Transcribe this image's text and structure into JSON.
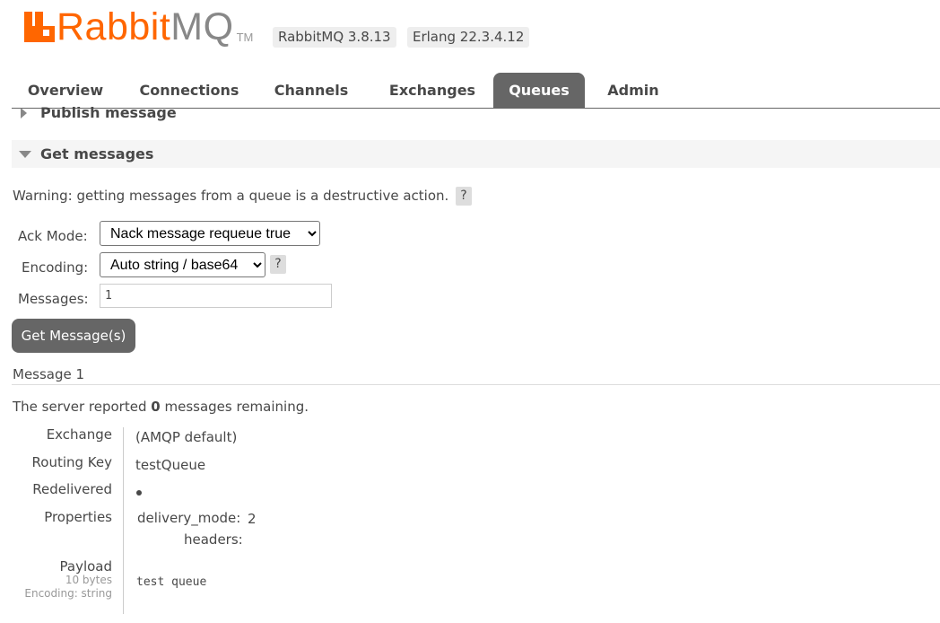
{
  "header": {
    "logo": {
      "brand": "Rabbit",
      "brand_suffix": "MQ",
      "trademark": "TM"
    },
    "rabbitmq_version": "RabbitMQ 3.8.13",
    "erlang_version": "Erlang 22.3.4.12"
  },
  "tabs": [
    {
      "label": "Overview",
      "active": false
    },
    {
      "label": "Connections",
      "active": false
    },
    {
      "label": "Channels",
      "active": false
    },
    {
      "label": "Exchanges",
      "active": false
    },
    {
      "label": "Queues",
      "active": true
    },
    {
      "label": "Admin",
      "active": false
    }
  ],
  "publish_section": {
    "title": "Publish message",
    "expanded": false
  },
  "get_section": {
    "title": "Get messages",
    "expanded": true,
    "warning": "Warning: getting messages from a queue is a destructive action.",
    "help_label": "?",
    "ack_mode": {
      "label": "Ack Mode:",
      "value": "Nack message requeue true"
    },
    "encoding": {
      "label": "Encoding:",
      "value": "Auto string / base64"
    },
    "messages": {
      "label": "Messages:",
      "value": "1"
    },
    "button_label": "Get Message(s)"
  },
  "result": {
    "message_heading": "Message 1",
    "remaining_prefix": "The server reported",
    "remaining_count": "0",
    "remaining_suffix": "messages remaining.",
    "details": {
      "exchange_label": "Exchange",
      "exchange_value": "(AMQP default)",
      "routing_key_label": "Routing Key",
      "routing_key_value": "testQueue",
      "redelivered_label": "Redelivered",
      "redelivered_value": true,
      "properties_label": "Properties",
      "properties": [
        {
          "key": "delivery_mode:",
          "value": "2"
        },
        {
          "key": "headers:",
          "value": ""
        }
      ],
      "payload_label": "Payload",
      "payload_size": "10 bytes",
      "payload_encoding": "Encoding: string",
      "payload_value": "test queue"
    }
  },
  "colors": {
    "brand_orange": "#ff6600",
    "tab_active_bg": "#666666",
    "text": "#484848"
  }
}
